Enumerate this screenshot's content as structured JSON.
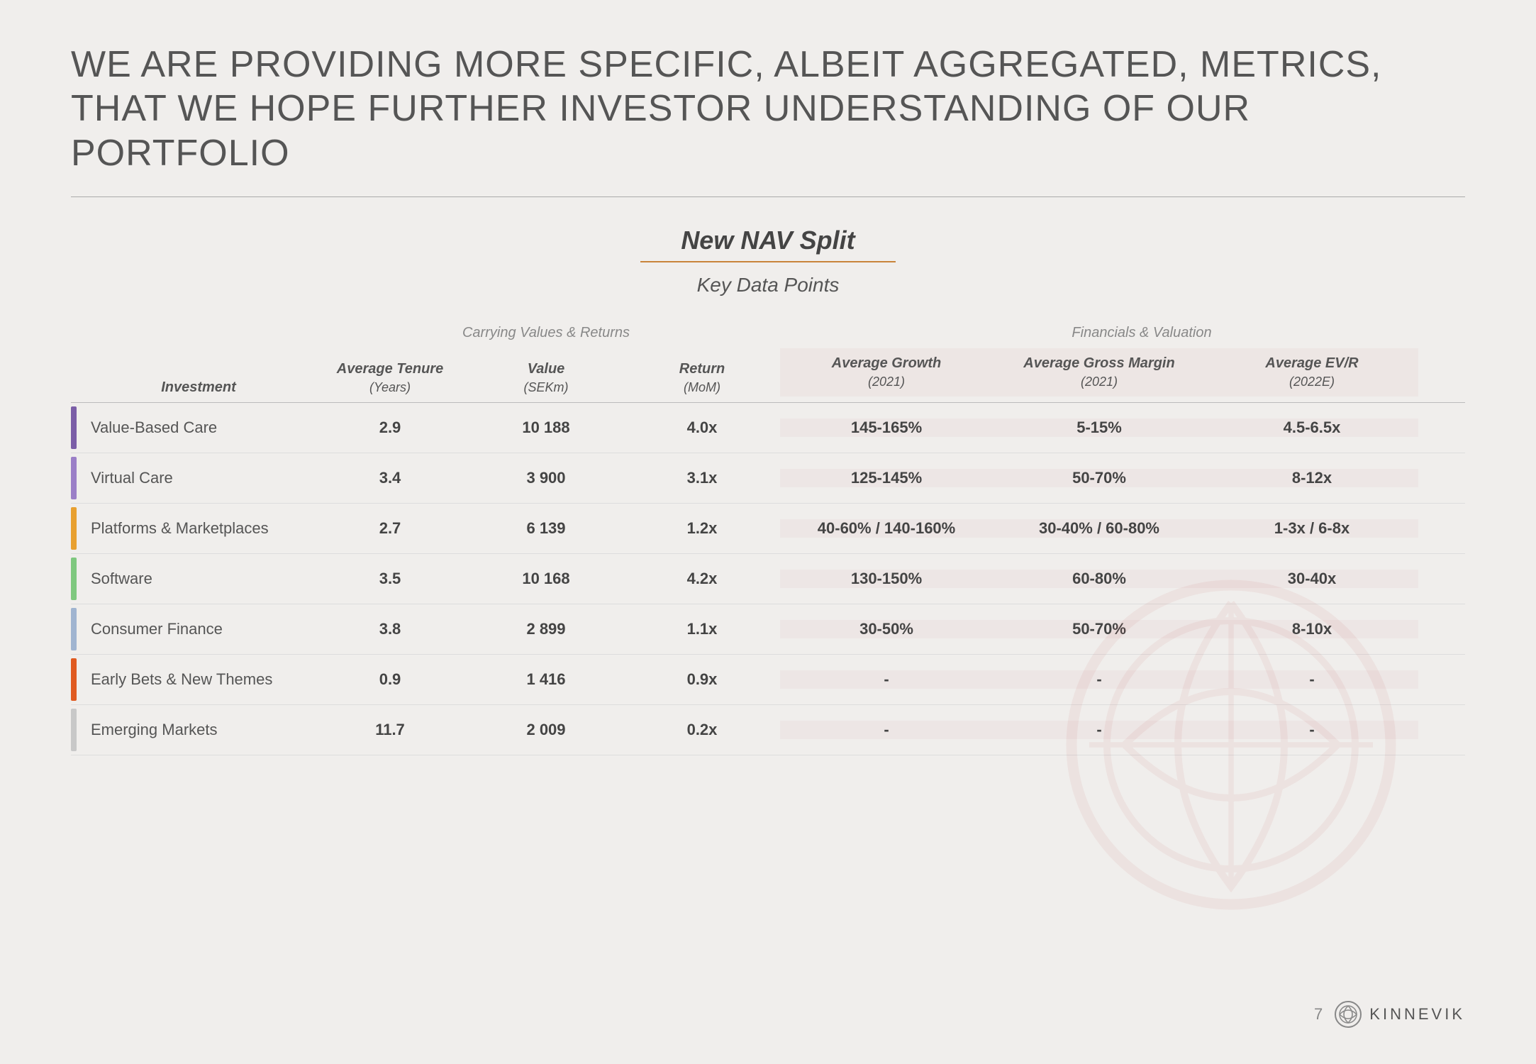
{
  "title_line1": "WE ARE PROVIDING MORE SPECIFIC, ALBEIT AGGREGATED, METRICS,",
  "title_line2": "THAT WE HOPE FURTHER INVESTOR UNDERSTANDING OF OUR PORTFOLIO",
  "nav_split": "New NAV Split",
  "key_data": "Key Data Points",
  "sections": {
    "carrying": "Carrying Values & Returns",
    "financials": "Financials & Valuation"
  },
  "col_headers": {
    "investment": "Investment",
    "tenure": "Average Tenure",
    "tenure_sub": "(Years)",
    "value": "Value",
    "value_sub": "(SEKm)",
    "return": "Return",
    "return_sub": "(MoM)",
    "growth": "Average Growth",
    "growth_sub": "(2021)",
    "margin": "Average Gross Margin",
    "margin_sub": "(2021)",
    "evr": "Average EV/R",
    "evr_sub": "(2022E)"
  },
  "rows": [
    {
      "name": "Value-Based Care",
      "color": "#7b5ea7",
      "tenure": "2.9",
      "value": "10 188",
      "return": "4.0x",
      "growth": "145-165%",
      "margin": "5-15%",
      "evr": "4.5-6.5x"
    },
    {
      "name": "Virtual Care",
      "color": "#9b7fc7",
      "tenure": "3.4",
      "value": "3 900",
      "return": "3.1x",
      "growth": "125-145%",
      "margin": "50-70%",
      "evr": "8-12x"
    },
    {
      "name": "Platforms & Marketplaces",
      "color": "#e8a030",
      "tenure": "2.7",
      "value": "6 139",
      "return": "1.2x",
      "growth": "40-60% / 140-160%",
      "margin": "30-40% / 60-80%",
      "evr": "1-3x / 6-8x"
    },
    {
      "name": "Software",
      "color": "#7fc87f",
      "tenure": "3.5",
      "value": "10 168",
      "return": "4.2x",
      "growth": "130-150%",
      "margin": "60-80%",
      "evr": "30-40x"
    },
    {
      "name": "Consumer Finance",
      "color": "#a0b4d0",
      "tenure": "3.8",
      "value": "2 899",
      "return": "1.1x",
      "growth": "30-50%",
      "margin": "50-70%",
      "evr": "8-10x"
    },
    {
      "name": "Early Bets & New Themes",
      "color": "#e05a20",
      "tenure": "0.9",
      "value": "1 416",
      "return": "0.9x",
      "growth": "-",
      "margin": "-",
      "evr": "-"
    },
    {
      "name": "Emerging Markets",
      "color": "#c8c8c8",
      "tenure": "11.7",
      "value": "2 009",
      "return": "0.2x",
      "growth": "-",
      "margin": "-",
      "evr": "-"
    }
  ],
  "footer": {
    "page": "7",
    "brand": "KINNEVIK"
  }
}
